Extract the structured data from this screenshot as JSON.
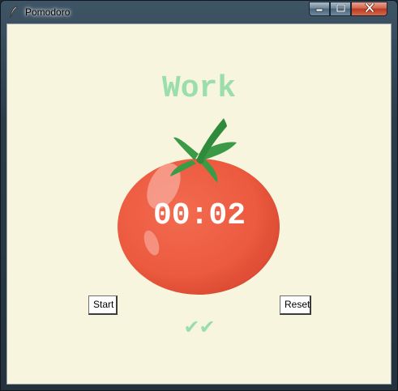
{
  "window": {
    "title": "Pomodoro",
    "controls": {
      "minimize_icon": "minimize-icon",
      "maximize_icon": "maximize-icon",
      "close_icon": "close-icon"
    }
  },
  "app": {
    "heading": "Work",
    "timer": "00:02",
    "start_label": "Start",
    "reset_label": "Reset",
    "checkmarks": "✔✔"
  },
  "colors": {
    "background": "#f7f5dd",
    "green": "#9bdeac",
    "tomato": "#f0604a",
    "stem": "#3a9a45"
  },
  "icons": {
    "app": "feather-icon",
    "tomato": "tomato-image"
  }
}
